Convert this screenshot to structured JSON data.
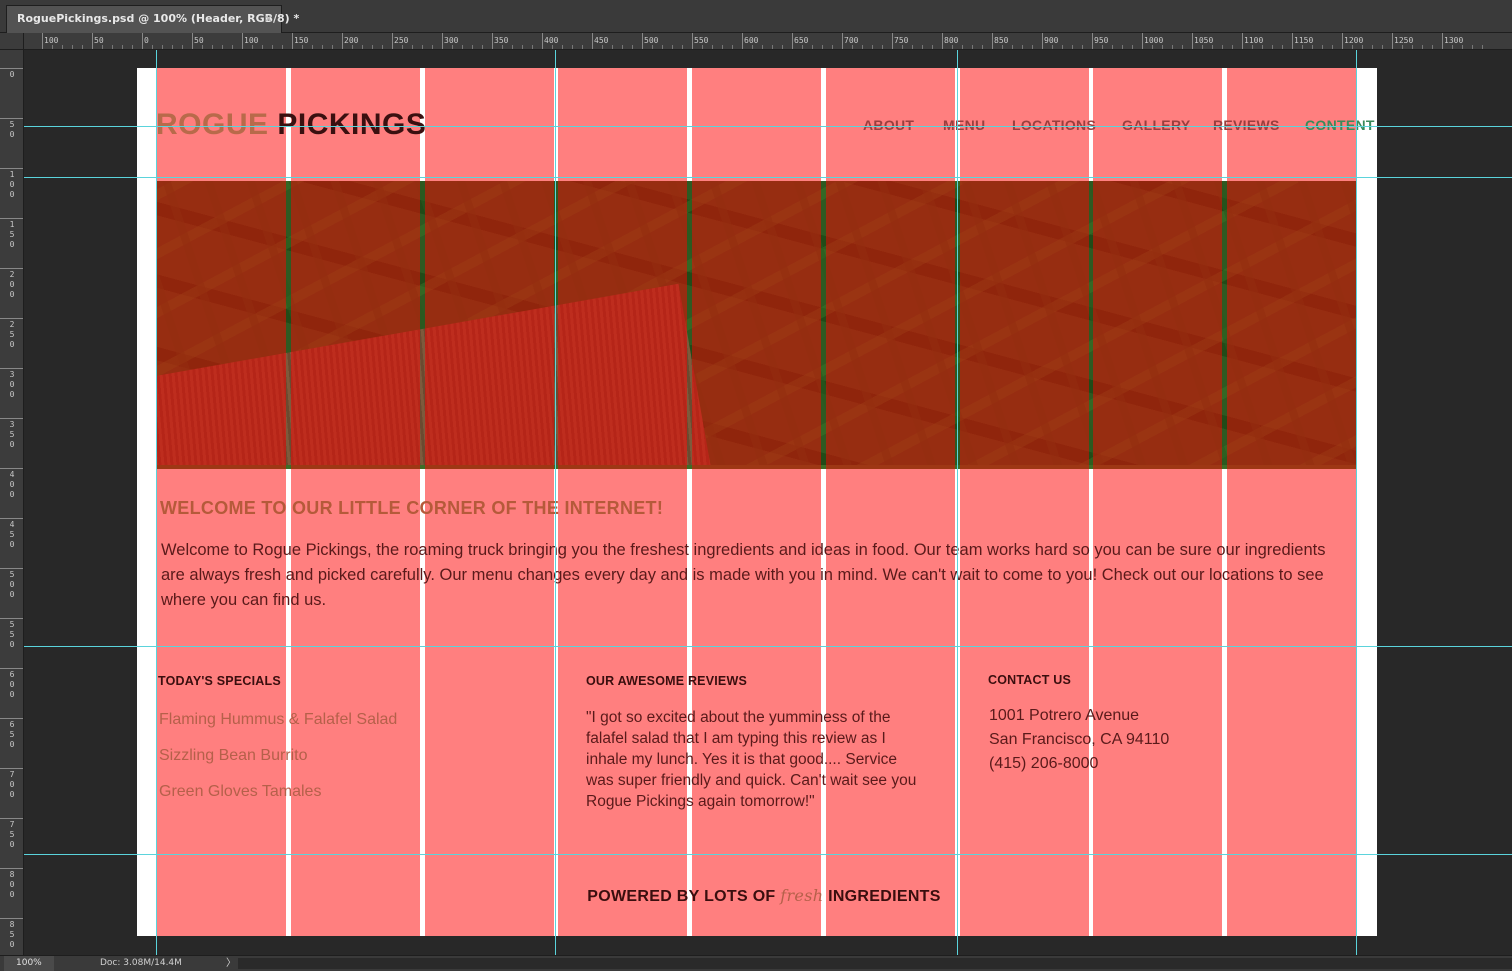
{
  "document_tab": {
    "title": "RoguePickings.psd @ 100% (Header, RGB/8) *",
    "close": "×"
  },
  "ruler": {
    "top_labels": [
      "100",
      "50",
      "0",
      "50",
      "100",
      "150",
      "200",
      "250",
      "300",
      "350",
      "400",
      "450",
      "500",
      "550",
      "600",
      "650",
      "700",
      "750",
      "800",
      "850",
      "900",
      "950",
      "1000",
      "1050",
      "1100",
      "1150",
      "1200",
      "1250",
      "1300"
    ],
    "left_labels": [
      "0",
      "50",
      "100",
      "150",
      "200",
      "250",
      "300",
      "350",
      "400",
      "450",
      "500",
      "550",
      "600",
      "650",
      "700",
      "750",
      "800",
      "850"
    ]
  },
  "site": {
    "logo_part1": "ROGUE",
    "logo_part2": "PICKINGS",
    "nav": [
      "ABOUT",
      "MENU",
      "LOCATIONS",
      "GALLERY",
      "REVIEWS",
      "CONTENT"
    ],
    "welcome_title": "WELCOME TO OUR LITTLE CORNER OF THE INTERNET!",
    "welcome_text": "Welcome to Rogue Pickings, the roaming truck bringing you the freshest ingredients and ideas in food. Our team works hard so you can be sure our ingredients are always fresh and picked carefully. Our menu changes every day and is made with you in mind. We can't wait to come to you! Check out our locations to see where you can find us.",
    "specials_title": "TODAY'S SPECIALS",
    "specials": [
      "Flaming Hummus & Falafel Salad",
      "Sizzling Bean Burrito",
      "Green Gloves Tamales"
    ],
    "reviews_title": "OUR AWESOME REVIEWS",
    "review_text": "\"I got so excited about the yumminess of the falafel salad that I am typing this review as I inhale my lunch. Yes it is that good.... Service was super friendly and quick. Can't wait see you Rogue Pickings again tomorrow!\"",
    "contact_title": "CONTACT US",
    "contact_lines": [
      "1001 Potrero Avenue",
      "San Francisco, CA 94110",
      "(415) 206-8000"
    ],
    "footer_before": "POWERED BY LOTS OF ",
    "footer_fresh": "fresh",
    "footer_after": " INGREDIENTS"
  },
  "status": {
    "zoom": "100%",
    "doc": "Doc: 3.08M/14.4M",
    "arrow": "〉"
  },
  "colors": {
    "column_overlay": "#ff0000",
    "guide": "#5ad4dc",
    "logo_accent": "#b86a4a",
    "logo_dark": "#3a1010"
  }
}
